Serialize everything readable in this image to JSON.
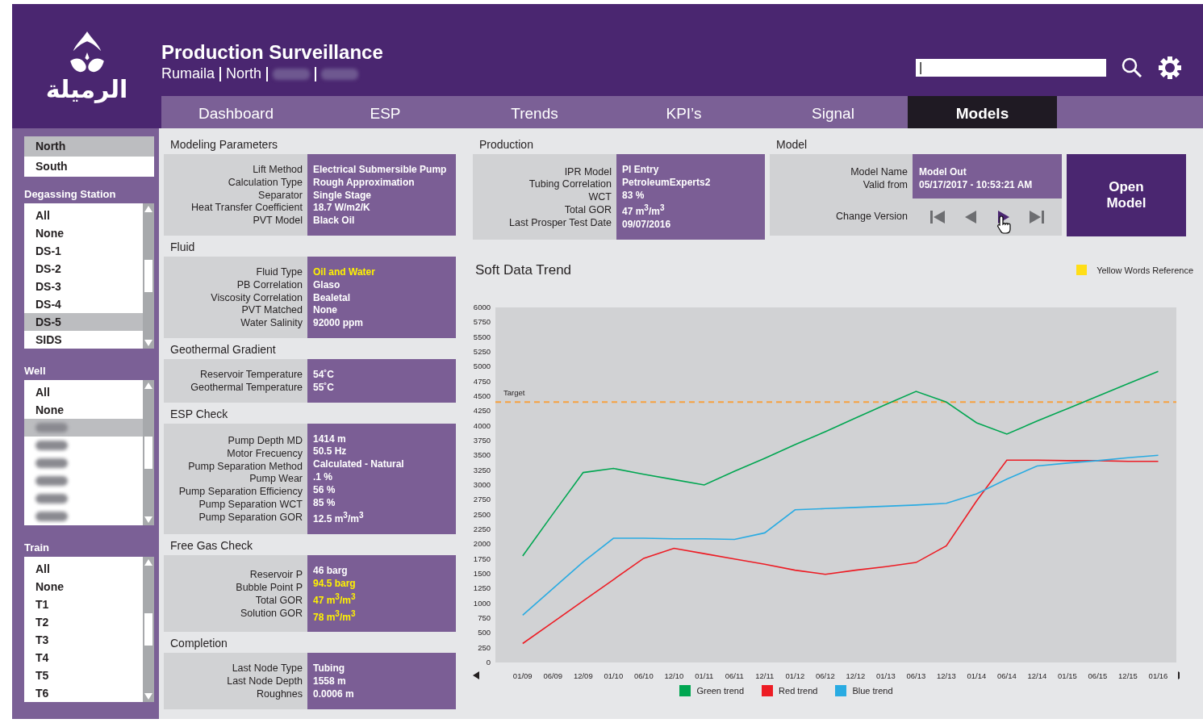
{
  "header": {
    "logo_text": "الرميلة",
    "title": "Production Surveillance",
    "breadcrumb": [
      {
        "label": "Rumaila",
        "redacted": false
      },
      {
        "label": "North",
        "redacted": false
      },
      {
        "redacted": true
      },
      {
        "redacted": true
      }
    ],
    "search": {
      "value": "|"
    }
  },
  "tabs": [
    {
      "label": "Dashboard",
      "selected": false
    },
    {
      "label": "ESP",
      "selected": false
    },
    {
      "label": "Trends",
      "selected": false
    },
    {
      "label": "KPI’s",
      "selected": false
    },
    {
      "label": "Signal",
      "selected": false
    },
    {
      "label": "Models",
      "selected": true
    }
  ],
  "sidebar": {
    "regions": [
      {
        "label": "North",
        "selected": true
      },
      {
        "label": "South",
        "selected": false
      }
    ],
    "lists": [
      {
        "title": "Degassing Station",
        "items": [
          {
            "label": "All",
            "selected": false,
            "redacted": false
          },
          {
            "label": "None",
            "selected": false,
            "redacted": false
          },
          {
            "label": "DS-1",
            "selected": false,
            "redacted": false
          },
          {
            "label": "DS-2",
            "selected": false,
            "redacted": false
          },
          {
            "label": "DS-3",
            "selected": false,
            "redacted": false
          },
          {
            "label": "DS-4",
            "selected": false,
            "redacted": false
          },
          {
            "label": "DS-5",
            "selected": true,
            "redacted": false
          },
          {
            "label": "SIDS",
            "selected": false,
            "redacted": false
          }
        ]
      },
      {
        "title": "Well",
        "items": [
          {
            "label": "All",
            "selected": false,
            "redacted": false
          },
          {
            "label": "None",
            "selected": false,
            "redacted": false
          },
          {
            "selected": true,
            "redacted": true
          },
          {
            "selected": false,
            "redacted": true
          },
          {
            "selected": false,
            "redacted": true
          },
          {
            "selected": false,
            "redacted": true
          },
          {
            "selected": false,
            "redacted": true
          },
          {
            "selected": false,
            "redacted": true
          }
        ]
      },
      {
        "title": "Train",
        "items": [
          {
            "label": "All",
            "selected": false,
            "redacted": false
          },
          {
            "label": "None",
            "selected": false,
            "redacted": false
          },
          {
            "label": "T1",
            "selected": false,
            "redacted": false
          },
          {
            "label": "T2",
            "selected": false,
            "redacted": false
          },
          {
            "label": "T3",
            "selected": false,
            "redacted": false
          },
          {
            "label": "T4",
            "selected": false,
            "redacted": false
          },
          {
            "label": "T5",
            "selected": false,
            "redacted": false
          },
          {
            "label": "T6",
            "selected": false,
            "redacted": false
          }
        ]
      }
    ]
  },
  "parameter_sections": [
    {
      "title": "Modeling Parameters",
      "rows": [
        {
          "label": "Lift Method",
          "value": "Electrical Submersible Pump",
          "highlight": false
        },
        {
          "label": "Calculation Type",
          "value": "Rough Approximation",
          "highlight": false
        },
        {
          "label": "Separator",
          "value": "Single Stage",
          "highlight": false
        },
        {
          "label": "Heat Transfer Coefficient",
          "value": "18.7 W/m2/K",
          "highlight": false
        },
        {
          "label": "PVT Model",
          "value": "Black Oil",
          "highlight": false
        }
      ]
    },
    {
      "title": "Fluid",
      "rows": [
        {
          "label": "Fluid Type",
          "value": "Oil and Water",
          "highlight": true
        },
        {
          "label": "PB Correlation",
          "value": "Glaso",
          "highlight": false
        },
        {
          "label": "Viscosity Correlation",
          "value": "Bealetal",
          "highlight": false
        },
        {
          "label": "PVT Matched",
          "value": "None",
          "highlight": false
        },
        {
          "label": "Water Salinity",
          "value": "92000 ppm",
          "highlight": false
        }
      ]
    },
    {
      "title": "Geothermal Gradient",
      "rows": [
        {
          "label": "Reservoir Temperature",
          "value": "54˚C",
          "highlight": false
        },
        {
          "label": "Geothermal Temperature",
          "value": "55˚C",
          "highlight": false
        }
      ]
    },
    {
      "title": "ESP Check",
      "rows": [
        {
          "label": "Pump Depth MD",
          "value": "1414 m",
          "highlight": false
        },
        {
          "label": "Motor Frecuency",
          "value": "50.5 Hz",
          "highlight": false
        },
        {
          "label": "Pump Separation Method",
          "value": "Calculated - Natural",
          "highlight": false
        },
        {
          "label": "Pump Wear",
          "value": ".1 %",
          "highlight": false
        },
        {
          "label": "Pump Separation Efficiency",
          "value": "56 %",
          "highlight": false
        },
        {
          "label": "Pump Separation WCT",
          "value": "85 %",
          "highlight": false
        },
        {
          "label": "Pump Separation GOR",
          "value": "12.5 m$^{3}$/m$^{3}$",
          "highlight": false
        }
      ]
    },
    {
      "title": "Free Gas Check",
      "rows": [
        {
          "label": "Reservoir P",
          "value": "46 barg",
          "highlight": false
        },
        {
          "label": "Bubble Point P",
          "value": "94.5 barg",
          "highlight": true
        },
        {
          "label": "Total GOR",
          "value": "47 m$^{3}$/m$^{3}$",
          "highlight": true
        },
        {
          "label": "Solution GOR",
          "value": "78 m$^{3}$/m$^{3}$",
          "highlight": true
        }
      ]
    },
    {
      "title": "Completion",
      "rows": [
        {
          "label": "Last Node Type",
          "value": "Tubing",
          "highlight": false
        },
        {
          "label": "Last Node Depth",
          "value": "1558 m",
          "highlight": false
        },
        {
          "label": "Roughnes",
          "value": "0.0006 m",
          "highlight": false
        }
      ]
    }
  ],
  "production": {
    "title": "Production",
    "rows": [
      {
        "label": "IPR Model",
        "value": "PI Entry"
      },
      {
        "label": "Tubing Correlation",
        "value": "PetroleumExperts2"
      },
      {
        "label": "WCT",
        "value": "83 %"
      },
      {
        "label": "Total GOR",
        "value": "47 m$^{3}$/m$^{3}$"
      },
      {
        "label": "Last Prosper Test Date",
        "value": "09/07/2016"
      }
    ]
  },
  "model": {
    "title": "Model",
    "rows": [
      {
        "label": "Model Name",
        "value": "Model Out"
      },
      {
        "label": "Valid from",
        "value": "05/17/2017 - 10:53:21 AM"
      }
    ],
    "change_label": "Change Version",
    "nav": [
      {
        "kind": "first",
        "selected": false
      },
      {
        "kind": "prev",
        "selected": false
      },
      {
        "kind": "next",
        "selected": true
      },
      {
        "kind": "last",
        "selected": false
      }
    ],
    "open_button": "Open Model"
  },
  "trend": {
    "title": "Soft Data Trend",
    "reference_legend": {
      "label": "Yellow Words Reference",
      "color": "#ffde17"
    },
    "chart_data": {
      "type": "line",
      "categories": [
        "01/09",
        "06/09",
        "12/09",
        "01/10",
        "06/10",
        "12/10",
        "01/11",
        "06/11",
        "12/11",
        "01/12",
        "06/12",
        "12/12",
        "01/13",
        "06/13",
        "12/13",
        "01/14",
        "06/14",
        "12/14",
        "01/15",
        "06/15",
        "12/15",
        "01/16"
      ],
      "series": [
        {
          "name": "Green trend",
          "color": "#00a651",
          "values": [
            1800,
            2510,
            3210,
            3280,
            3180,
            3090,
            3000,
            3230,
            3450,
            3680,
            3900,
            4130,
            4360,
            4580,
            4400,
            4050,
            3860,
            4080,
            4290,
            4500,
            4710,
            4920
          ]
        },
        {
          "name": "Red trend",
          "color": "#ed1c24",
          "values": [
            320,
            680,
            1040,
            1400,
            1760,
            1930,
            1840,
            1750,
            1660,
            1560,
            1490,
            1560,
            1620,
            1690,
            1970,
            2730,
            3420,
            3420,
            3410,
            3410,
            3400,
            3400
          ]
        },
        {
          "name": "Blue trend",
          "color": "#29abe2",
          "values": [
            800,
            1250,
            1700,
            2100,
            2100,
            2090,
            2090,
            2080,
            2190,
            2580,
            2600,
            2620,
            2640,
            2660,
            2690,
            2850,
            3100,
            3320,
            3370,
            3410,
            3460,
            3500
          ]
        }
      ],
      "ylim": [
        0,
        6000
      ],
      "yticks": [
        0,
        250,
        500,
        750,
        1000,
        1250,
        1500,
        1750,
        2000,
        2250,
        2500,
        2750,
        3000,
        3250,
        3500,
        3750,
        4000,
        4250,
        4500,
        4750,
        5000,
        5250,
        5500,
        5750,
        6000
      ],
      "ref_lines": [
        {
          "axis": "y",
          "value": 4400,
          "label": "Target"
        }
      ]
    }
  }
}
